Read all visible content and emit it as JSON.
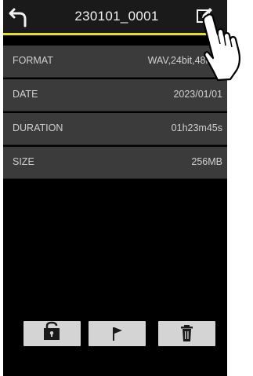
{
  "header": {
    "title": "230101_0001"
  },
  "info": [
    {
      "label": "FORMAT",
      "value": "WAV,24bit,48kHz"
    },
    {
      "label": "DATE",
      "value": "2023/01/01"
    },
    {
      "label": "DURATION",
      "value": "01h23m45s"
    },
    {
      "label": "SIZE",
      "value": "256MB"
    }
  ],
  "icons": {
    "back": "back-arrow-icon",
    "edit": "edit-icon",
    "protect": "lock-icon",
    "mark": "flag-icon",
    "delete": "trash-icon",
    "hand": "pointing-hand-icon"
  },
  "colors": {
    "accent": "#e3df2b",
    "screen_bg": "#000000",
    "row_bg": "#3b3b3b",
    "button_bg": "#d4d4d4"
  }
}
